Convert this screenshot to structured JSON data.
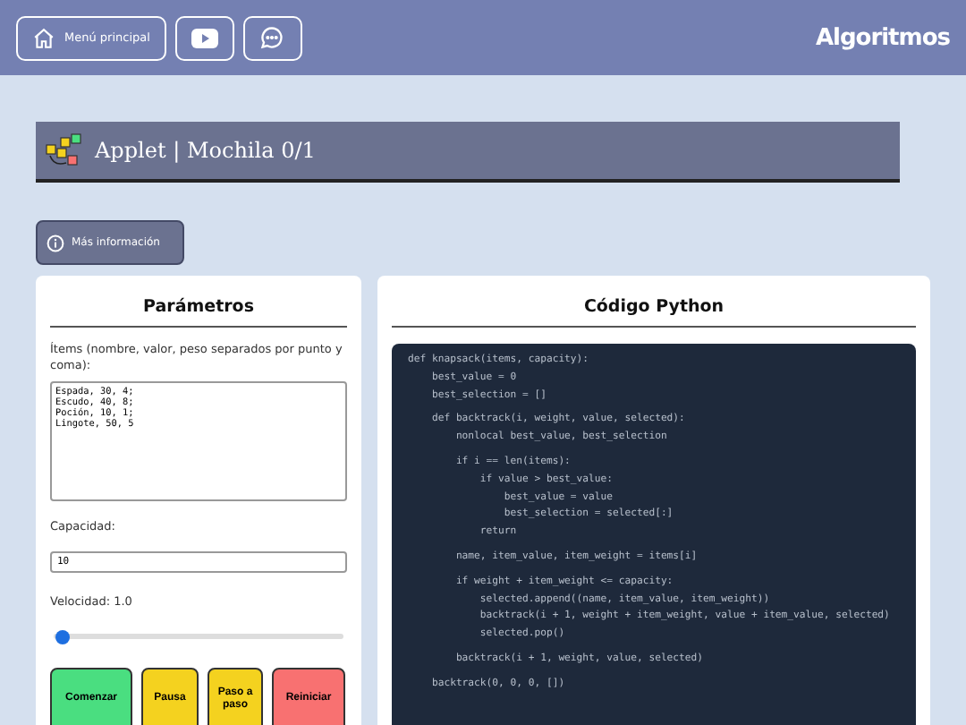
{
  "header": {
    "home_button": "Menú principal",
    "logo": "Algoritmos"
  },
  "title_bar": {
    "title": "Applet | Mochila 0/1"
  },
  "info_button": "Más información",
  "parameters": {
    "heading": "Parámetros",
    "items_label": "Ítems (nombre, valor, peso separados por punto y coma):",
    "items_value": "Espada, 30, 4;\nEscudo, 40, 8;\nPoción, 10, 1;\nLingote, 50, 5",
    "capacity_label": "Capacidad:",
    "capacity_value": "10",
    "speed_label": "Velocidad: 1.0",
    "speed": {
      "level": 0.03
    },
    "buttons": [
      {
        "label": "Comenzar",
        "kind": "start"
      },
      {
        "label": "Pausa",
        "kind": "pause"
      },
      {
        "label": "Paso a paso",
        "kind": "step"
      },
      {
        "label": "Reiniciar",
        "kind": "reset"
      }
    ]
  },
  "code": {
    "heading": "Código Python",
    "blocks": [
      "def knapsack(items, capacity):\n    best_value = 0\n    best_selection = []",
      "    def backtrack(i, weight, value, selected):\n        nonlocal best_value, best_selection",
      "        if i == len(items):\n            if value > best_value:\n                best_value = value\n                best_selection = selected[:]\n            return",
      "        name, item_value, item_weight = items[i]",
      "        if weight + item_weight <= capacity:\n            selected.append((name, item_value, item_weight))\n            backtrack(i + 1, weight + item_weight, value + item_value, selected)\n            selected.pop()",
      "        backtrack(i + 1, weight, value, selected)",
      "    backtrack(0, 0, 0, [])"
    ]
  }
}
